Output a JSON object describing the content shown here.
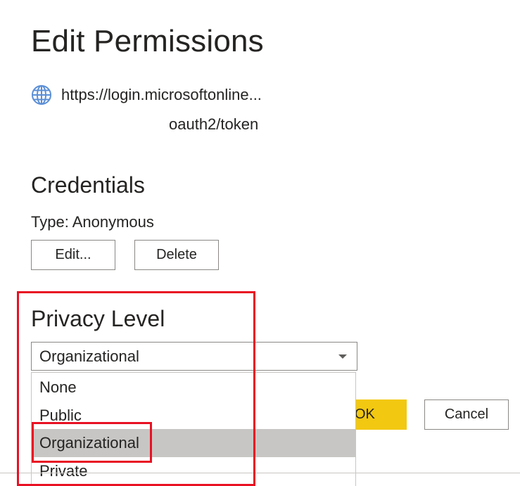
{
  "dialog": {
    "title": "Edit Permissions",
    "source_icon": "globe-icon",
    "url_line1": "https://login.microsoftonline...",
    "url_line2": "oauth2/token"
  },
  "credentials": {
    "heading": "Credentials",
    "type_text": "Type: Anonymous",
    "edit_label": "Edit...",
    "delete_label": "Delete"
  },
  "privacy": {
    "heading": "Privacy Level",
    "selected": "Organizational",
    "options": [
      "None",
      "Public",
      "Organizational",
      "Private"
    ],
    "highlighted_option": "Organizational"
  },
  "footer": {
    "ok_label": "OK",
    "cancel_label": "Cancel"
  },
  "colors": {
    "ok_button": "#f2c811",
    "highlighted_option_bg": "#c8c6c4",
    "annotation_box": "#e81123",
    "text": "#252423"
  }
}
